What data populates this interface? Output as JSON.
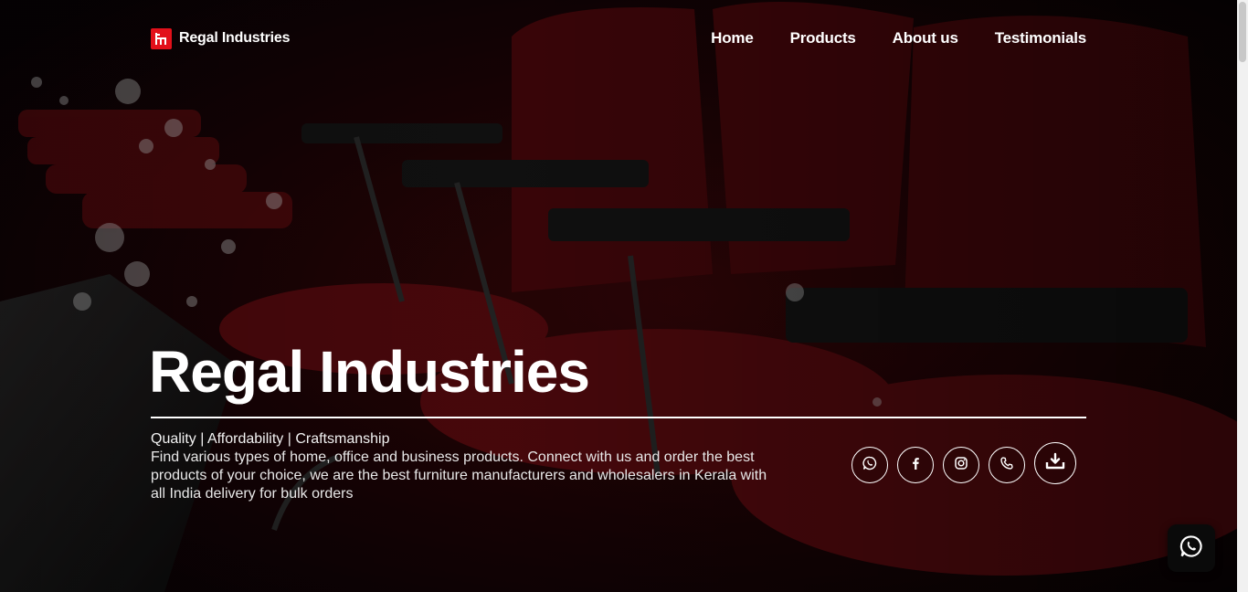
{
  "brand": {
    "name": "Regal Industries",
    "accent_color": "#e2101a",
    "logo_icon": "chair-logo-icon"
  },
  "nav": {
    "items": [
      {
        "label": "Home"
      },
      {
        "label": "Products"
      },
      {
        "label": "About us"
      },
      {
        "label": "Testimonials"
      }
    ]
  },
  "hero": {
    "title": "Regal Industries",
    "tagline": "Quality | Affordability | Craftsmanship",
    "description": "Find various types of home, office and business products. Connect with us and order the best products of your choice, we are the best furniture manufacturers and wholesalers in Kerala with all India delivery for bulk orders"
  },
  "socials": [
    {
      "icon": "whatsapp-icon"
    },
    {
      "icon": "facebook-icon"
    },
    {
      "icon": "instagram-icon"
    },
    {
      "icon": "phone-icon"
    },
    {
      "icon": "download-icon"
    }
  ],
  "floating_chat": {
    "icon": "whatsapp-icon"
  }
}
